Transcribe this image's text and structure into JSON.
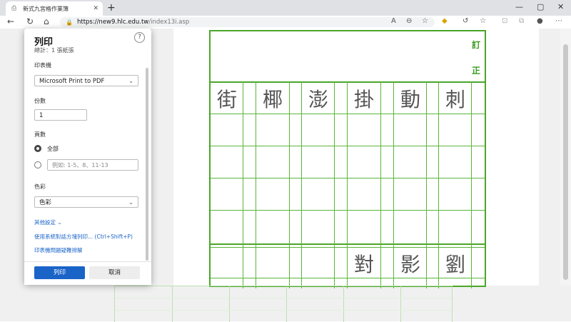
{
  "browser": {
    "tab_title": "新式九宮格作業簿",
    "new_tab": "+",
    "url_host": "https://new9.hlc.edu.tw",
    "url_path": "/index13i.asp",
    "win_min": "—",
    "win_max": "▢",
    "win_close": "✕"
  },
  "worksheet": {
    "correction_1": "訂",
    "correction_2": "正",
    "row1_chars": [
      "街",
      "椰",
      "澎",
      "掛",
      "動",
      "刺"
    ],
    "row2_chars": [
      "對",
      "影",
      "劉"
    ],
    "line_color": "#4aa628"
  },
  "print_dialog": {
    "title": "列印",
    "subtitle": "總計：1 張紙張",
    "printer_label": "印表機",
    "printer_value": "Microsoft Print to PDF",
    "copies_label": "份數",
    "copies_value": "1",
    "pages_label": "頁數",
    "pages_all": "全部",
    "pages_range_placeholder": "例如: 1-5、8、11-13",
    "color_label": "色彩",
    "color_value": "色彩",
    "more_settings": "其他設定 ⌄",
    "system_dialog": "使用系統對話方塊列印... (Ctrl+Shift+P)",
    "printer_troubleshoot": "印表機問題疑難排解",
    "print_button": "列印",
    "cancel_button": "取消",
    "accent_color": "#1a64c8"
  }
}
